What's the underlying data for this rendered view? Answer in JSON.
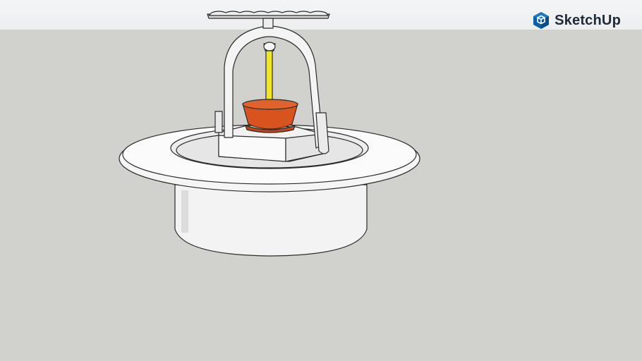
{
  "app": {
    "brand": "SketchUp",
    "logo_icon": "sketchup-cube-icon",
    "logo_color": "#0d5fa6"
  },
  "scene": {
    "background_sky": "#eef0f1",
    "background_ground": "#d1d1cd",
    "colors": {
      "body": "#f2f2f2",
      "outline": "#2a2a2a",
      "bulb": "#d8531e",
      "glass_tube": "#f0e52a"
    }
  }
}
